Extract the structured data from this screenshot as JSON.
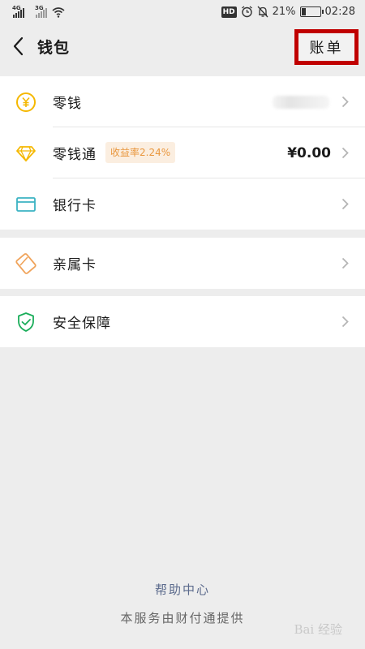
{
  "status_bar": {
    "sim1": "4G",
    "sim2": "3G",
    "hd": "HD",
    "battery_percent": "21%",
    "time": "02:28"
  },
  "nav": {
    "title": "钱包",
    "bill_label": "账单"
  },
  "wallet_items": [
    {
      "label": "零钱",
      "icon": "yuan-coin-icon",
      "value": "",
      "value_blurred": true
    },
    {
      "label": "零钱通",
      "icon": "diamond-icon",
      "badge": "收益率2.24%",
      "value": "¥0.00"
    },
    {
      "label": "银行卡",
      "icon": "bank-card-icon"
    }
  ],
  "family_card": {
    "label": "亲属卡",
    "icon": "family-card-icon"
  },
  "security": {
    "label": "安全保障",
    "icon": "shield-check-icon"
  },
  "footer": {
    "help": "帮助中心",
    "provider": "本服务由财付通提供"
  },
  "watermark": "Bai 经验",
  "colors": {
    "background": "#ededed",
    "highlight_border": "#c00000",
    "gold": "#f5b800",
    "teal": "#3bb3c3",
    "orange": "#f0a35a",
    "green": "#1aad5a",
    "badge_text": "#e9973e"
  }
}
